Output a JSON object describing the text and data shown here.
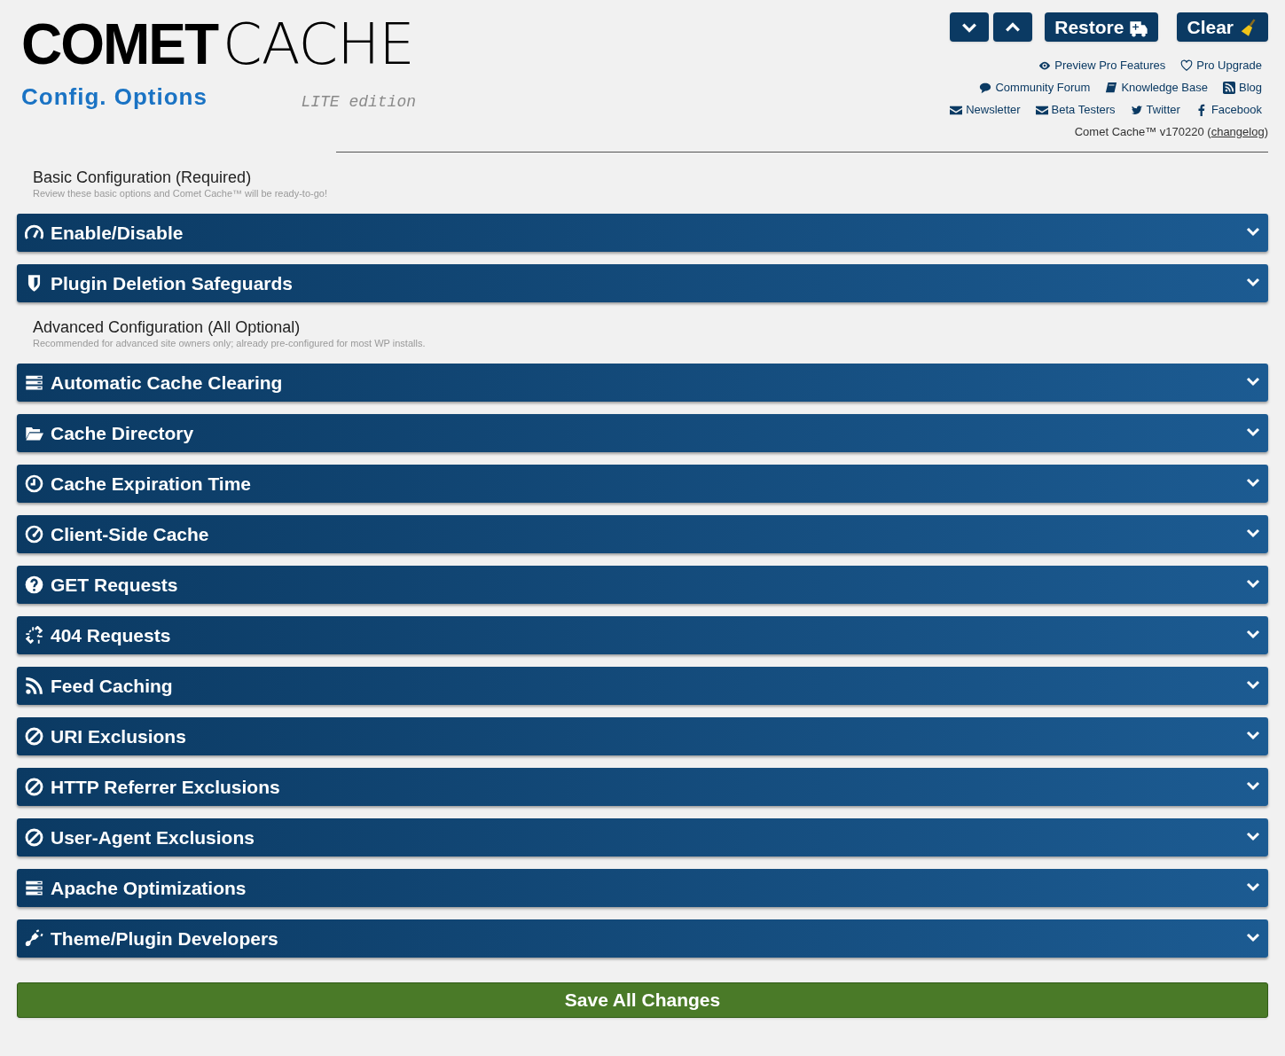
{
  "logo": {
    "brand_bold": "COMET",
    "brand_light": "CACHE",
    "subtitle": "Config. Options",
    "edition": "LITE edition"
  },
  "header_buttons": [
    {
      "kind": "down"
    },
    {
      "kind": "up"
    },
    {
      "kind": "restore",
      "label": "Restore"
    },
    {
      "kind": "clear",
      "label": "Clear"
    }
  ],
  "links": [
    [
      {
        "label": "Preview Pro Features"
      },
      {
        "label": "Pro Upgrade"
      }
    ],
    [
      {
        "label": "Community Forum"
      },
      {
        "label": "Knowledge Base"
      },
      {
        "label": "Blog"
      }
    ],
    [
      {
        "label": "Newsletter"
      },
      {
        "label": "Beta Testers"
      },
      {
        "label": "Twitter"
      },
      {
        "label": "Facebook"
      }
    ]
  ],
  "version": {
    "text": "Comet Cache™ v170220 (",
    "link": "changelog",
    "close": ")"
  },
  "groups": [
    {
      "heading": "Basic Configuration (Required)",
      "description": "Review these basic options and Comet Cache™ will be ready-to-go!",
      "panels": [
        {
          "title": "Enable/Disable",
          "expanded": false
        },
        {
          "title": "Plugin Deletion Safeguards",
          "expanded": false
        }
      ]
    },
    {
      "heading": "Advanced Configuration (All Optional)",
      "description": "Recommended for advanced site owners only; already pre-configured for most WP installs.",
      "panels": [
        {
          "title": "Automatic Cache Clearing",
          "expanded": false
        },
        {
          "title": "Cache Directory",
          "expanded": false
        },
        {
          "title": "Cache Expiration Time",
          "expanded": false
        },
        {
          "title": "Client-Side Cache",
          "expanded": false
        },
        {
          "title": "GET Requests",
          "expanded": false
        },
        {
          "title": "404 Requests",
          "expanded": false
        },
        {
          "title": "Feed Caching",
          "expanded": false
        },
        {
          "title": "URI Exclusions",
          "expanded": false
        },
        {
          "title": "HTTP Referrer Exclusions",
          "expanded": false
        },
        {
          "title": "User-Agent Exclusions",
          "expanded": false
        },
        {
          "title": "Apache Optimizations",
          "expanded": false
        },
        {
          "title": "Theme/Plugin Developers",
          "expanded": false
        }
      ]
    }
  ],
  "save_button": "Save All Changes"
}
